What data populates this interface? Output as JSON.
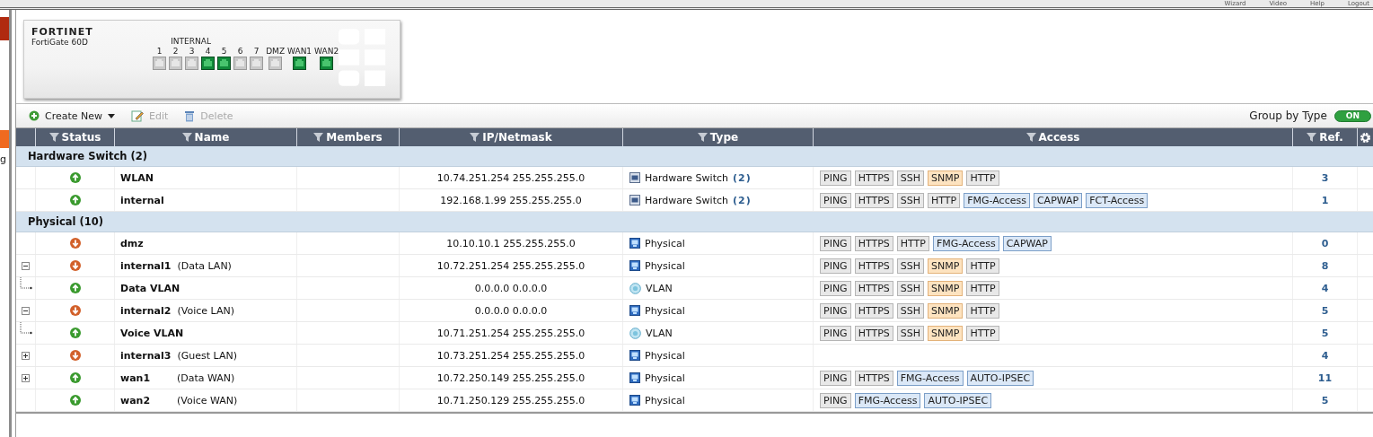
{
  "top_links": [
    "Wizard",
    "Video",
    "Help",
    "Logout"
  ],
  "sidebar": {
    "cut_text": "g"
  },
  "device": {
    "brand": "FORTINET",
    "model": "FortiGate 60D",
    "group_label": "INTERNAL",
    "ports": [
      {
        "label": "1",
        "up": false
      },
      {
        "label": "2",
        "up": false
      },
      {
        "label": "3",
        "up": false
      },
      {
        "label": "4",
        "up": true
      },
      {
        "label": "5",
        "up": true
      },
      {
        "label": "6",
        "up": false
      },
      {
        "label": "7",
        "up": false
      },
      {
        "label": "DMZ",
        "up": false
      },
      {
        "label": "WAN1",
        "up": true
      },
      {
        "label": "WAN2",
        "up": true
      }
    ]
  },
  "toolbar": {
    "buttons": [
      {
        "label": "Create New",
        "kind": "create",
        "disabled": false
      },
      {
        "label": "Edit",
        "kind": "edit",
        "disabled": true
      },
      {
        "label": "Delete",
        "kind": "delete",
        "disabled": true
      }
    ],
    "group_by": {
      "label": "Group by Type",
      "on": true,
      "state_text": "ON"
    }
  },
  "table": {
    "columns": [
      "Status",
      "Name",
      "Members",
      "IP/Netmask",
      "Type",
      "Access",
      "Ref."
    ],
    "groups": [
      {
        "title": "Hardware Switch (2)",
        "rows": [
          {
            "up": true,
            "name": "WLAN",
            "ip": "10.74.251.254 255.255.255.0",
            "type": {
              "kind": "switch",
              "label": "Hardware Switch",
              "count": "(2)"
            },
            "access": [
              {
                "label": "PING",
                "kind": "plain"
              },
              {
                "label": "HTTPS",
                "kind": "plain"
              },
              {
                "label": "SSH",
                "kind": "plain"
              },
              {
                "label": "SNMP",
                "kind": "warn"
              },
              {
                "label": "HTTP",
                "kind": "plain"
              }
            ],
            "ref": "3"
          },
          {
            "up": true,
            "name": "internal",
            "ip": "192.168.1.99 255.255.255.0",
            "type": {
              "kind": "switch",
              "label": "Hardware Switch",
              "count": "(2)"
            },
            "access": [
              {
                "label": "PING",
                "kind": "plain"
              },
              {
                "label": "HTTPS",
                "kind": "plain"
              },
              {
                "label": "SSH",
                "kind": "plain"
              },
              {
                "label": "HTTP",
                "kind": "plain"
              },
              {
                "label": "FMG-Access",
                "kind": "info"
              },
              {
                "label": "CAPWAP",
                "kind": "info"
              },
              {
                "label": "FCT-Access",
                "kind": "info"
              }
            ],
            "ref": "1"
          }
        ]
      },
      {
        "title": "Physical (10)",
        "rows": [
          {
            "up": false,
            "name": "dmz",
            "ip": "10.10.10.1 255.255.255.0",
            "type": {
              "kind": "physical",
              "label": "Physical"
            },
            "access": [
              {
                "label": "PING",
                "kind": "plain"
              },
              {
                "label": "HTTPS",
                "kind": "plain"
              },
              {
                "label": "HTTP",
                "kind": "plain"
              },
              {
                "label": "FMG-Access",
                "kind": "info"
              },
              {
                "label": "CAPWAP",
                "kind": "info"
              }
            ],
            "ref": "0"
          },
          {
            "expandable": true,
            "expanded": true,
            "up": false,
            "name": "internal1",
            "alias": "(Data LAN)",
            "ip": "10.72.251.254 255.255.255.0",
            "type": {
              "kind": "physical",
              "label": "Physical"
            },
            "access": [
              {
                "label": "PING",
                "kind": "plain"
              },
              {
                "label": "HTTPS",
                "kind": "plain"
              },
              {
                "label": "SSH",
                "kind": "plain"
              },
              {
                "label": "SNMP",
                "kind": "warn"
              },
              {
                "label": "HTTP",
                "kind": "plain"
              }
            ],
            "ref": "8",
            "children": [
              {
                "up": true,
                "name": "Data VLAN",
                "ip": "0.0.0.0 0.0.0.0",
                "type": {
                  "kind": "vlan",
                  "label": "VLAN"
                },
                "access": [
                  {
                    "label": "PING",
                    "kind": "plain"
                  },
                  {
                    "label": "HTTPS",
                    "kind": "plain"
                  },
                  {
                    "label": "SSH",
                    "kind": "plain"
                  },
                  {
                    "label": "SNMP",
                    "kind": "warn"
                  },
                  {
                    "label": "HTTP",
                    "kind": "plain"
                  }
                ],
                "ref": "4"
              }
            ]
          },
          {
            "expandable": true,
            "expanded": true,
            "up": false,
            "name": "internal2",
            "alias": "(Voice LAN)",
            "ip": "0.0.0.0 0.0.0.0",
            "type": {
              "kind": "physical",
              "label": "Physical"
            },
            "access": [
              {
                "label": "PING",
                "kind": "plain"
              },
              {
                "label": "HTTPS",
                "kind": "plain"
              },
              {
                "label": "SSH",
                "kind": "plain"
              },
              {
                "label": "SNMP",
                "kind": "warn"
              },
              {
                "label": "HTTP",
                "kind": "plain"
              }
            ],
            "ref": "5",
            "children": [
              {
                "up": true,
                "name": "Voice VLAN",
                "ip": "10.71.251.254 255.255.255.0",
                "type": {
                  "kind": "vlan",
                  "label": "VLAN"
                },
                "access": [
                  {
                    "label": "PING",
                    "kind": "plain"
                  },
                  {
                    "label": "HTTPS",
                    "kind": "plain"
                  },
                  {
                    "label": "SSH",
                    "kind": "plain"
                  },
                  {
                    "label": "SNMP",
                    "kind": "warn"
                  },
                  {
                    "label": "HTTP",
                    "kind": "plain"
                  }
                ],
                "ref": "5"
              }
            ]
          },
          {
            "expandable": true,
            "expanded": false,
            "up": false,
            "name": "internal3",
            "alias": "(Guest LAN)",
            "ip": "10.73.251.254 255.255.255.0",
            "type": {
              "kind": "physical",
              "label": "Physical"
            },
            "access": [],
            "ref": "4"
          },
          {
            "expandable": true,
            "expanded": false,
            "up": true,
            "name": "wan1",
            "alias": "(Data WAN)",
            "ip": "10.72.250.149 255.255.255.0",
            "type": {
              "kind": "physical",
              "label": "Physical"
            },
            "access": [
              {
                "label": "PING",
                "kind": "plain"
              },
              {
                "label": "HTTPS",
                "kind": "plain"
              },
              {
                "label": "FMG-Access",
                "kind": "info"
              },
              {
                "label": "AUTO-IPSEC",
                "kind": "info"
              }
            ],
            "ref": "11"
          },
          {
            "up": true,
            "name": "wan2",
            "alias": "(Voice WAN)",
            "ip": "10.71.250.129 255.255.255.0",
            "type": {
              "kind": "physical",
              "label": "Physical"
            },
            "access": [
              {
                "label": "PING",
                "kind": "plain"
              },
              {
                "label": "FMG-Access",
                "kind": "info"
              },
              {
                "label": "AUTO-IPSEC",
                "kind": "info"
              }
            ],
            "ref": "5"
          }
        ]
      }
    ]
  }
}
